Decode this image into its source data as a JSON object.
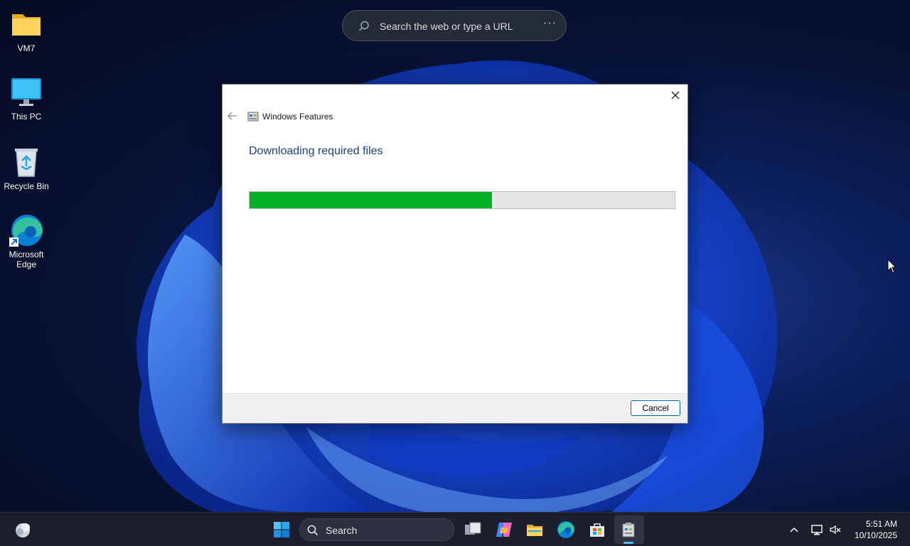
{
  "desktop": {
    "icons": [
      {
        "label": "VM7",
        "icon": "folder-icon"
      },
      {
        "label": "This PC",
        "icon": "monitor-icon"
      },
      {
        "label": "Recycle Bin",
        "icon": "recycle-bin-icon"
      },
      {
        "label": "Microsoft Edge",
        "icon": "edge-icon"
      }
    ]
  },
  "web_search": {
    "placeholder": "Search the web or type a URL",
    "more": "···"
  },
  "dialog": {
    "title": "Windows Features",
    "heading": "Downloading required files",
    "progress_percent": 57,
    "cancel_label": "Cancel",
    "colors": {
      "progress_fill": "#06b025",
      "heading": "#1c3f8c"
    }
  },
  "taskbar": {
    "search_label": "Search",
    "apps": [
      "widgets-icon",
      "start-icon",
      "search-icon",
      "task-view-icon",
      "copilot-icon",
      "file-explorer-icon",
      "edge-icon",
      "store-icon",
      "windows-features-icon"
    ],
    "clock": {
      "time": "5:51 AM",
      "date": "10/10/2025"
    }
  }
}
